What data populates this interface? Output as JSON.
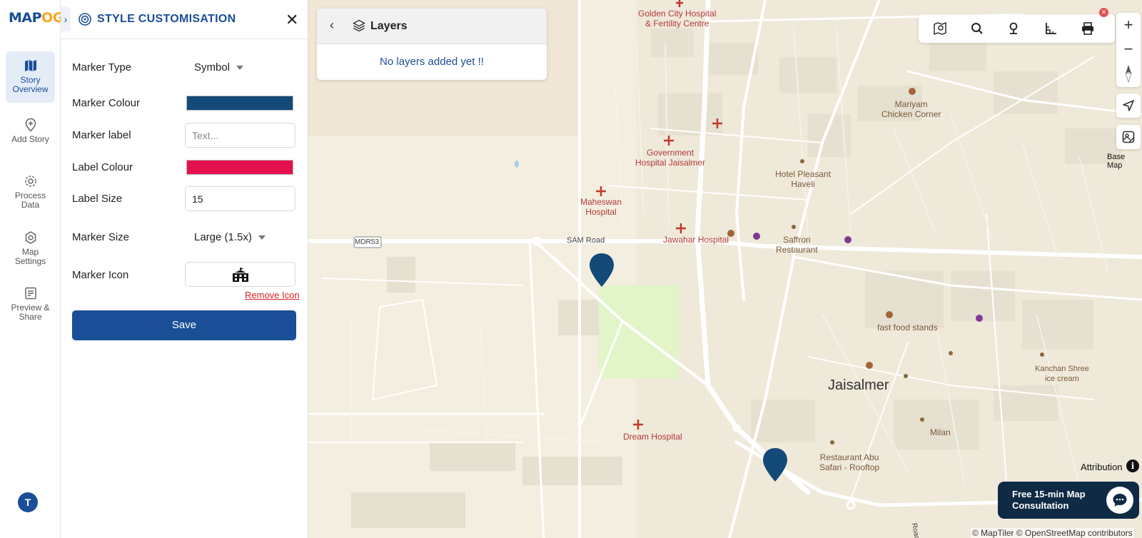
{
  "logo": {
    "part1": "MAP",
    "part2": "OG"
  },
  "nav": [
    {
      "label": "Story Overview",
      "icon": "map-icon",
      "active": true
    },
    {
      "label": "Add Story",
      "icon": "add-pin-icon"
    },
    {
      "label": "Process Data",
      "icon": "gear-icon"
    },
    {
      "label": "Map Settings",
      "icon": "settings-icon"
    },
    {
      "label": "Preview & Share",
      "icon": "preview-icon"
    }
  ],
  "user": {
    "avatar_initial": "T"
  },
  "panel": {
    "title": "STYLE CUSTOMISATION",
    "marker_type": {
      "label": "Marker Type",
      "value": "Symbol"
    },
    "marker_colour": {
      "label": "Marker Colour",
      "color": "#134a78"
    },
    "marker_label": {
      "label": "Marker label",
      "placeholder": "Text...",
      "value": ""
    },
    "label_colour": {
      "label": "Label Colour",
      "color": "#e5114e"
    },
    "label_size": {
      "label": "Label Size",
      "value": "15"
    },
    "marker_size": {
      "label": "Marker Size",
      "value": "Large (1.5x)"
    },
    "marker_icon": {
      "label": "Marker Icon",
      "icon": "school-building-icon",
      "remove_label": "Remove Icon"
    },
    "save_label": "Save"
  },
  "layers": {
    "title": "Layers",
    "empty_message": "No layers added yet !!"
  },
  "map": {
    "base_map_label": "Base Map",
    "attribution_label": "Attribution",
    "consultation": {
      "line1": "Free 15-min Map",
      "line2": "Consultation"
    },
    "copyright": "© MapTiler © OpenStreetMap contributors",
    "labels": {
      "golden_city": "Golden City Hospital",
      "golden_city_2": "& Fertility Centre",
      "mariyam": "Mariyam",
      "mariyam_2": "Chicken Corner",
      "govt": "Government",
      "govt_2": "Hospital Jaisalmer",
      "hotel_pleasant": "Hotel Pleasant",
      "hotel_pleasant_2": "Haveli",
      "maheswan": "Maheswan",
      "maheswan_2": "Hospital",
      "jawahar": "Jawahar Hospital",
      "saffron": "Saffron",
      "saffron_2": "Restaurant",
      "mdr53": "MDR53",
      "sam_road": "SAM Road",
      "fast_food": "fast food stands",
      "kanchan": "Kanchan Shree",
      "kanchan_2": "ice cream",
      "jaisalmer": "Jaisalmer",
      "dream": "Dream Hospital",
      "milan": "Milan",
      "abu_safari": "Restaurant Abu",
      "abu_safari_2": "Safari - Rooftop",
      "road": "Road"
    }
  }
}
